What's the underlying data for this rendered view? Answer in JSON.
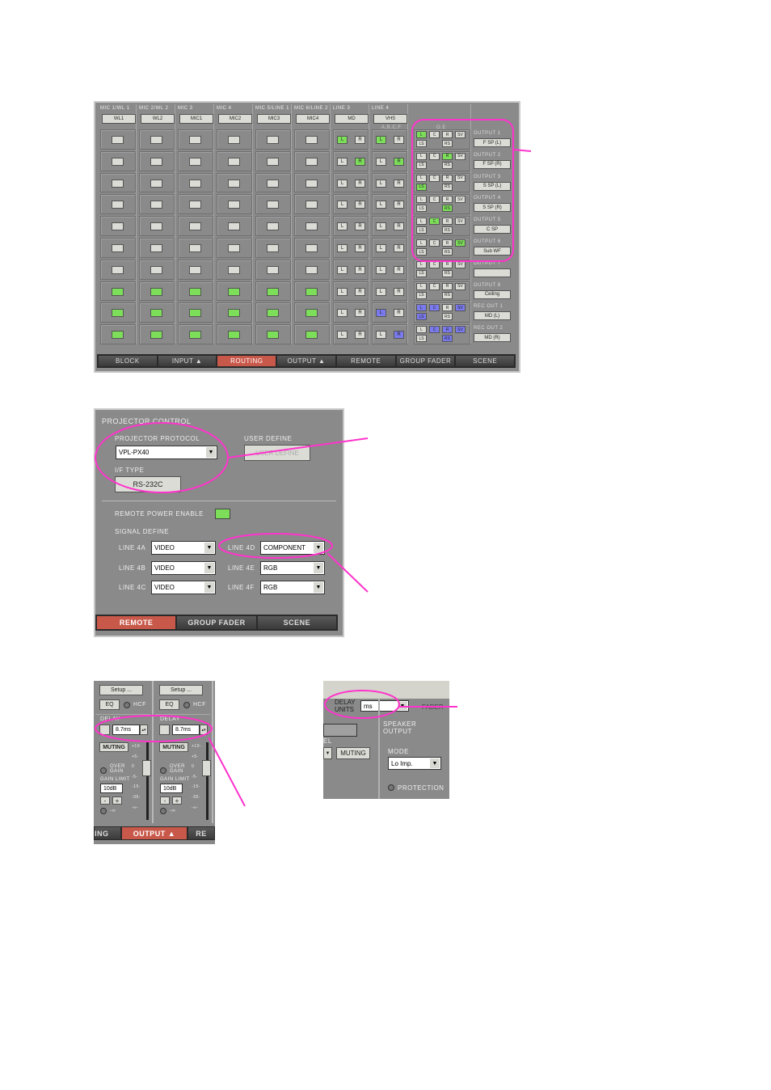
{
  "routing": {
    "columns": [
      {
        "header": "MIC 1/WL 1",
        "source": "WL1"
      },
      {
        "header": "MIC 2/WL 2",
        "source": "WL2"
      },
      {
        "header": "MIC 3",
        "source": "MIC1"
      },
      {
        "header": "MIC 4",
        "source": "MIC2"
      },
      {
        "header": "MIC 5/LINE 1",
        "source": "MIC3"
      },
      {
        "header": "MIC 6/LINE 2",
        "source": "MIC4"
      },
      {
        "header": "LINE 3",
        "source": "MD"
      },
      {
        "header": "LINE 4",
        "source": "VHS"
      }
    ],
    "line4_sub": "A,B,C,F",
    "oe_header": "O.E",
    "oe_buttons": [
      "L",
      "C",
      "R",
      "SV",
      "LS",
      "RS"
    ],
    "lr_buttons": [
      "L",
      "R"
    ],
    "colors": {
      "green": "#7dde5a",
      "blue": "#7a7aee",
      "pink": "#ff33cc"
    },
    "rows": [
      {
        "mic": "off",
        "line3": [
          "green",
          ""
        ],
        "line4": [
          "green",
          ""
        ],
        "oe": {
          "L": "green"
        },
        "output_label": "OUTPUT 1",
        "output": "F SP (L)"
      },
      {
        "mic": "off",
        "line3": [
          "",
          "green"
        ],
        "line4": [
          "",
          "green"
        ],
        "oe": {
          "R": "green"
        },
        "output_label": "OUTPUT 2",
        "output": "F SP (R)"
      },
      {
        "mic": "off",
        "line3": [
          "",
          ""
        ],
        "line4": [
          "",
          ""
        ],
        "oe": {
          "LS": "green"
        },
        "output_label": "OUTPUT 3",
        "output": "S SP (L)"
      },
      {
        "mic": "off",
        "line3": [
          "",
          ""
        ],
        "line4": [
          "",
          ""
        ],
        "oe": {
          "RS": "green"
        },
        "output_label": "OUTPUT 4",
        "output": "S SP (R)"
      },
      {
        "mic": "off",
        "line3": [
          "",
          ""
        ],
        "line4": [
          "",
          ""
        ],
        "oe": {
          "C": "green"
        },
        "output_label": "OUTPUT 5",
        "output": "C SP"
      },
      {
        "mic": "off",
        "line3": [
          "",
          ""
        ],
        "line4": [
          "",
          ""
        ],
        "oe": {
          "SV": "green"
        },
        "output_label": "OUTPUT 6",
        "output": "Sub WF"
      },
      {
        "mic": "off",
        "line3": [
          "",
          ""
        ],
        "line4": [
          "",
          ""
        ],
        "oe": {},
        "output_label": "OUTPUT 7",
        "output": ""
      },
      {
        "mic": "green",
        "line3": [
          "",
          ""
        ],
        "line4": [
          "",
          ""
        ],
        "oe": {},
        "output_label": "OUTPUT 8",
        "output": "Ceiling"
      },
      {
        "mic": "green",
        "line3": [
          "",
          ""
        ],
        "line4": [
          "blue",
          ""
        ],
        "oe": {
          "L": "blue",
          "C": "blue",
          "SV": "blue",
          "LS": "blue"
        },
        "output_label": "REC OUT 1",
        "output": "MD (L)"
      },
      {
        "mic": "green",
        "line3": [
          "",
          ""
        ],
        "line4": [
          "",
          "blue"
        ],
        "oe": {
          "C": "blue",
          "R": "blue",
          "SV": "blue",
          "RS": "blue"
        },
        "output_label": "REC OUT 2",
        "output": "MD (R)"
      }
    ],
    "tabs": [
      {
        "label": "BLOCK"
      },
      {
        "label": "INPUT ▲"
      },
      {
        "label": "ROUTING",
        "active": true
      },
      {
        "label": "OUTPUT ▲"
      },
      {
        "label": "REMOTE"
      },
      {
        "label": "GROUP FADER"
      },
      {
        "label": "SCENE"
      }
    ]
  },
  "projector": {
    "title": "PROJECTOR CONTROL",
    "protocol_label": "PROJECTOR PROTOCOL",
    "protocol_value": "VPL-PX40",
    "user_define_label": "USER DEFINE",
    "user_define_button": "USER DEFINE",
    "if_type_label": "I/F TYPE",
    "if_type_value": "RS-232C",
    "remote_power_label": "REMOTE POWER ENABLE",
    "signal_define_label": "SIGNAL DEFINE",
    "lines": [
      {
        "label": "LINE 4A",
        "value": "VIDEO"
      },
      {
        "label": "LINE 4B",
        "value": "VIDEO"
      },
      {
        "label": "LINE 4C",
        "value": "VIDEO"
      },
      {
        "label": "LINE 4D",
        "value": "COMPONENT"
      },
      {
        "label": "LINE 4E",
        "value": "RGB"
      },
      {
        "label": "LINE 4F",
        "value": "RGB"
      }
    ],
    "tabs": {
      "remote": "REMOTE",
      "group_fader": "GROUP FADER",
      "scene": "SCENE"
    }
  },
  "output_strip": {
    "setup": "Setup ...",
    "eq": "EQ",
    "hcf": "HCF",
    "delay_label": "DELAY",
    "delay_value": "8.7ms",
    "muting": "MUTING",
    "over_gain": "OVER GAIN",
    "gain_limit_label": "GAIN LIMIT",
    "gain_limit_value": "10dB",
    "minus": "-",
    "plus": "+",
    "inf": "-∞",
    "scale": [
      "+10-",
      "+5-",
      "0",
      "-5-",
      "-15-",
      "-35-",
      "-∞-"
    ],
    "tabs": {
      "left": "ING",
      "output": "OUTPUT ▲",
      "right": "RE"
    }
  },
  "delay_units": {
    "label": "DELAY UNITS",
    "value": "ms",
    "fader": "FADER",
    "el": "EL",
    "muting": "MUTING",
    "speaker_output": "SPEAKER OUTPUT",
    "mode_label": "MODE",
    "mode_value": "Lo Imp.",
    "protection": "PROTECTION"
  }
}
